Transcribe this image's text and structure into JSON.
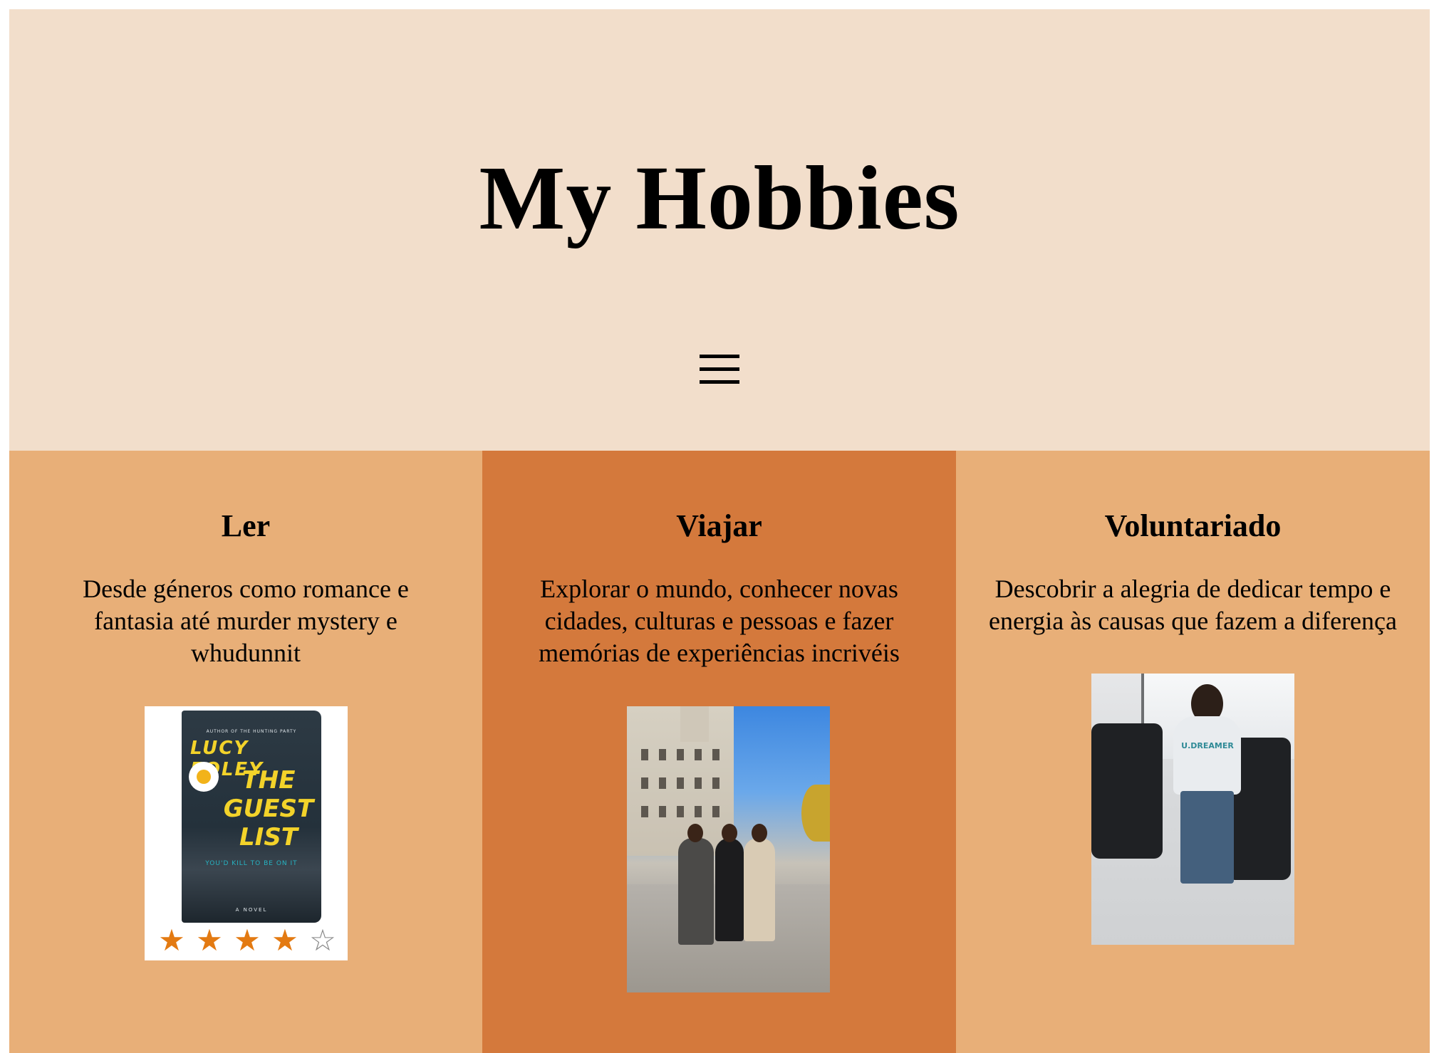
{
  "header": {
    "title": "My Hobbies",
    "menu_icon": "hamburger-menu-icon"
  },
  "hobbies": [
    {
      "title": "Ler",
      "description": "Desde géneros como romance e fantasia até murder mystery e whudunnit",
      "image": {
        "type": "book-cover",
        "author": "LUCY FOLEY",
        "book_title": "THE GUEST LIST",
        "top_text": "AUTHOR OF THE HUNTING PARTY",
        "tagline": "YOU'D KILL TO BE ON IT",
        "footer": "A NOVEL",
        "rating": 4,
        "rating_max": 5,
        "star_filled_color": "#e37a12",
        "star_empty_color": "#888888"
      }
    },
    {
      "title": "Viajar",
      "description": "Explorar o mundo, conhecer novas cidades, culturas e pessoas e fazer memórias de experiências incrivéis",
      "image": {
        "type": "photo",
        "subject": "three friends on a city street"
      }
    },
    {
      "title": "Voluntariado",
      "description": "Descobrir a alegria de dedicar tempo e energia às causas que fazem a diferença",
      "image": {
        "type": "photo",
        "subject": "volunteer with wheelchairs",
        "shirt_text": "U.DREAMER"
      }
    }
  ],
  "colors": {
    "header_bg": "#f2decb",
    "column_light": "#e8af78",
    "column_dark": "#d4793c"
  }
}
